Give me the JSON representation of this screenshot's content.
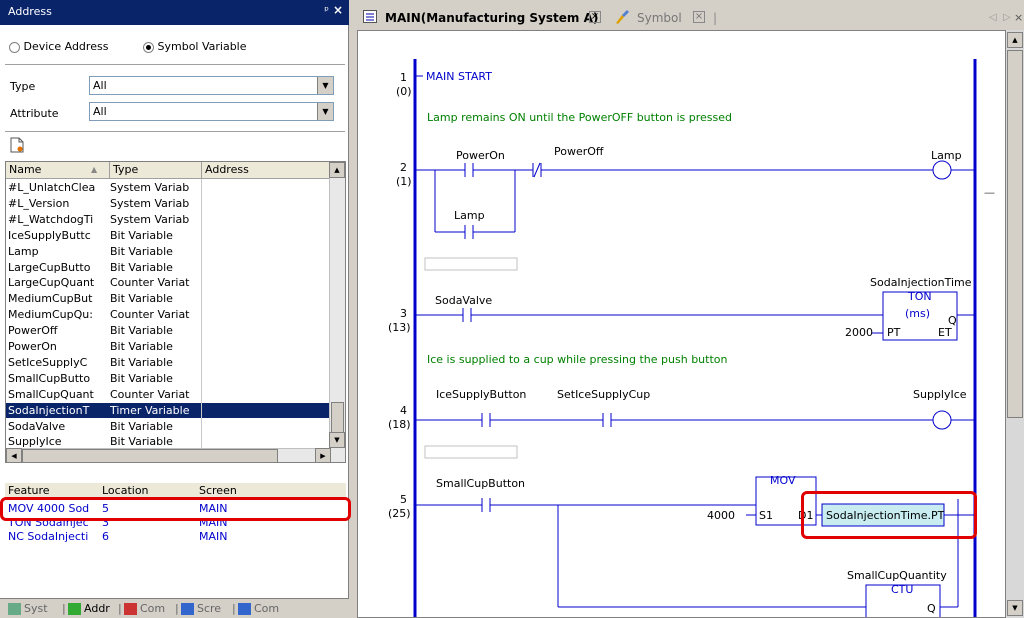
{
  "address_panel": {
    "title": "Address",
    "pin_glyph": "ᵖ",
    "close_glyph": "×",
    "radio_device": "Device Address",
    "radio_symbol": "Symbol Variable",
    "type_label": "Type",
    "type_value": "All",
    "attribute_label": "Attribute",
    "attribute_value": "All",
    "columns": [
      "Name",
      "Type",
      "Address"
    ],
    "rows": [
      {
        "name": "#L_UnlatchClea",
        "type": "System Variab"
      },
      {
        "name": "#L_Version",
        "type": "System Variab"
      },
      {
        "name": "#L_WatchdogTi",
        "type": "System Variab"
      },
      {
        "name": "IceSupplyButtc",
        "type": "Bit Variable"
      },
      {
        "name": "Lamp",
        "type": "Bit Variable"
      },
      {
        "name": "LargeCupButto",
        "type": "Bit Variable"
      },
      {
        "name": "LargeCupQuant",
        "type": "Counter Variat"
      },
      {
        "name": "MediumCupBut",
        "type": "Bit Variable"
      },
      {
        "name": "MediumCupQu:",
        "type": "Counter Variat"
      },
      {
        "name": "PowerOff",
        "type": "Bit Variable"
      },
      {
        "name": "PowerOn",
        "type": "Bit Variable"
      },
      {
        "name": "SetIceSupplyC",
        "type": "Bit Variable"
      },
      {
        "name": "SmallCupButto",
        "type": "Bit Variable"
      },
      {
        "name": "SmallCupQuant",
        "type": "Counter Variat"
      },
      {
        "name": "SodaInjectionT",
        "type": "Timer Variable"
      },
      {
        "name": "SodaValve",
        "type": "Bit Variable"
      },
      {
        "name": "SupplyIce",
        "type": "Bit Variable"
      }
    ],
    "selected_index": 14,
    "feature_columns": [
      "Feature",
      "Location",
      "Screen"
    ],
    "feature_rows": [
      {
        "feature": "MOV 4000 Sod",
        "location": "5",
        "screen": "MAIN"
      },
      {
        "feature": "TON SodaInjec",
        "location": "3",
        "screen": "MAIN"
      },
      {
        "feature": "NC SodaInjecti",
        "location": "6",
        "screen": "MAIN"
      }
    ],
    "bottom_tabs": [
      "Syst",
      "Addr",
      "Com",
      "Scre",
      "Com"
    ]
  },
  "editor": {
    "tab_main": "MAIN(Manufacturing System A)",
    "tab_symbol": "Symbol",
    "rungs": [
      {
        "num": "1",
        "step": "(0)",
        "label": "MAIN START"
      },
      {
        "num": "2",
        "step": "(1)"
      },
      {
        "num": "3",
        "step": "(13)"
      },
      {
        "num": "4",
        "step": "(18)"
      },
      {
        "num": "5",
        "step": "(25)"
      }
    ],
    "comment1": "Lamp remains ON until the  PowerOFF button is pressed",
    "comment2": "Ice is supplied to a cup while pressing the push button",
    "labels": {
      "poweron": "PowerOn",
      "poweroff": "PowerOff",
      "lamp_coil": "Lamp",
      "lamp_contact": "Lamp",
      "sodavalve": "SodaValve",
      "sodatime": "SodaInjectionTime",
      "ton": "TON",
      "ms": "(ms)",
      "q": "Q",
      "pt": "PT",
      "et": "ET",
      "pt_val": "2000",
      "icebutton": "IceSupplyButton",
      "setice": "SetIceSupplyCup",
      "supplyice": "SupplyIce",
      "smallcup": "SmallCupButton",
      "mov": "MOV",
      "mov_val": "4000",
      "s1": "S1",
      "d1": "D1",
      "dest": "SodaInjectionTime.PT",
      "smallqty": "SmallCupQuantity",
      "ctu": "CTU",
      "q2": "Q"
    }
  }
}
